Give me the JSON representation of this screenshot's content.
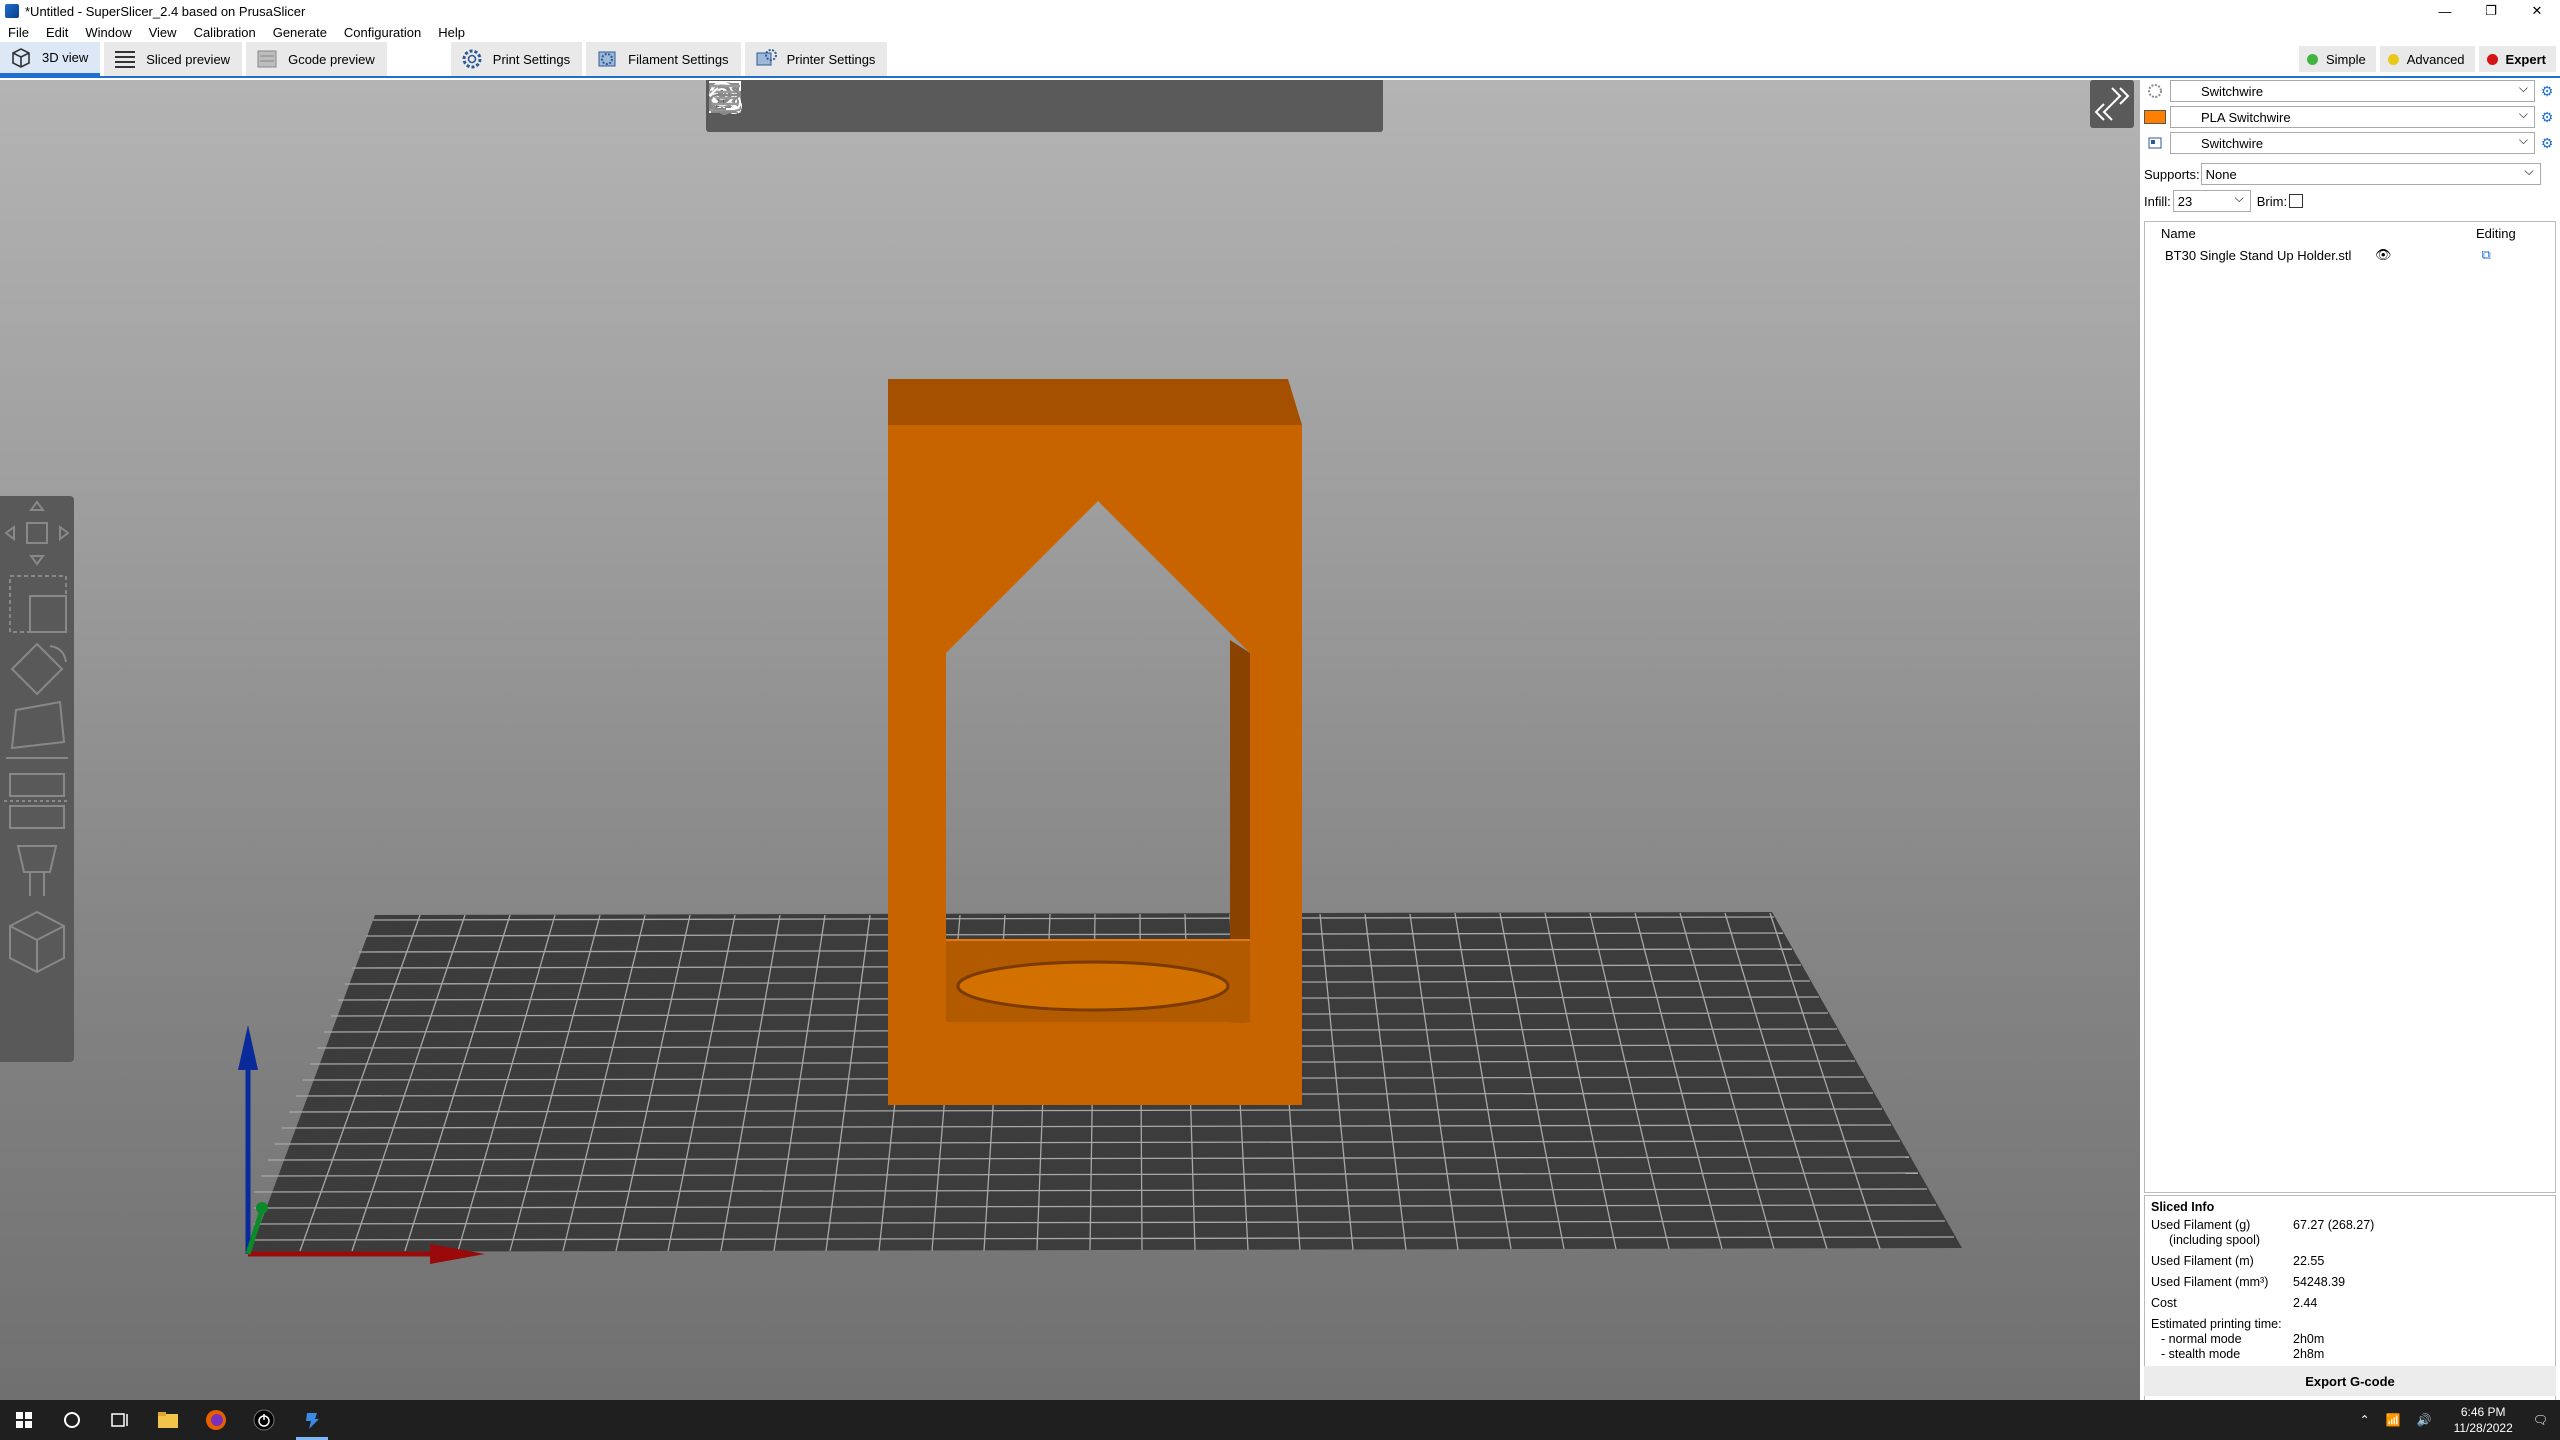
{
  "window": {
    "title": "*Untitled - SuperSlicer_2.4  based on PrusaSlicer",
    "controls": [
      "—",
      "❐",
      "✕"
    ]
  },
  "menu": [
    "File",
    "Edit",
    "Window",
    "View",
    "Calibration",
    "Generate",
    "Configuration",
    "Help"
  ],
  "tabs": [
    {
      "label": "3D view",
      "icon": "cube-icon",
      "active": true
    },
    {
      "label": "Sliced preview",
      "icon": "layers-icon"
    },
    {
      "label": "Gcode preview",
      "icon": "gcode-icon"
    },
    {
      "label": "Print Settings",
      "icon": "gear-icon"
    },
    {
      "label": "Filament Settings",
      "icon": "spool-icon"
    },
    {
      "label": "Printer Settings",
      "icon": "printer-icon"
    }
  ],
  "modes": [
    {
      "label": "Simple",
      "color": "#43b33f"
    },
    {
      "label": "Advanced",
      "color": "#e8c91a"
    },
    {
      "label": "Expert",
      "color": "#d41414",
      "active": true
    }
  ],
  "presets": {
    "print": "Switchwire",
    "filament": "PLA Switchwire",
    "filament_color": "#ff8000",
    "printer": "Switchwire"
  },
  "options": {
    "supports_label": "Supports:",
    "supports_value": "None",
    "infill_label": "Infill:",
    "infill_value": "23",
    "brim_label": "Brim:"
  },
  "object_list": {
    "col_name": "Name",
    "col_editing": "Editing",
    "items": [
      {
        "name": "BT30 Single Stand Up Holder.stl"
      }
    ]
  },
  "sliced_info": {
    "title": "Sliced Info",
    "rows": [
      {
        "key": "Used Filament (g)",
        "value": "67.27 (268.27)"
      },
      {
        "key": "(including spool)",
        "value": ""
      },
      {
        "key": "Used Filament (m)",
        "value": "22.55"
      },
      {
        "key": "Used Filament (mm³)",
        "value": "54248.39"
      },
      {
        "key": "Cost",
        "value": "2.44"
      },
      {
        "key": "Estimated printing time:",
        "value": ""
      },
      {
        "key": "- normal mode",
        "value": "2h0m"
      },
      {
        "key": "- stealth mode",
        "value": "2h8m"
      }
    ]
  },
  "export_button": "Export G-code",
  "model_color": "#c86400",
  "taskbar": {
    "time": "6:46 PM",
    "date": "11/28/2022"
  }
}
